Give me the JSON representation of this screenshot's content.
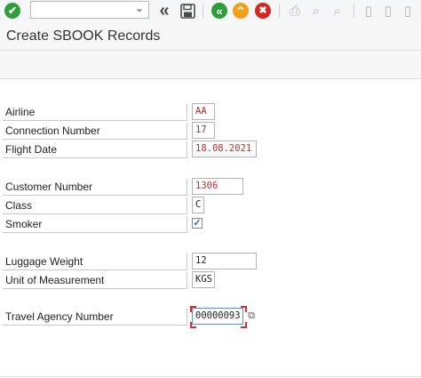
{
  "toolbar": {
    "command_field_value": "",
    "icons": [
      "enter-icon",
      "dropdown-chevron-icon",
      "back-chevron-icon",
      "save-icon",
      "back-icon",
      "exit-icon",
      "cancel-icon",
      "print-icon",
      "find-icon",
      "find-next-icon",
      "first-page-icon",
      "previous-page-icon",
      "next-page-icon"
    ],
    "glyphs": {
      "enter": "✔",
      "chevron": "⌄",
      "double_left": "«",
      "back": "«",
      "exit": "⌃",
      "cancel": "✖",
      "print": "⎙",
      "find": "⌕",
      "find_next": "⌕",
      "page_a": "▯",
      "page_b": "▯",
      "page_c": "▯"
    },
    "colors": {
      "enter": "#2e9d3a",
      "back": "#2e9d3a",
      "exit": "#f0a21a",
      "cancel": "#d7261e"
    }
  },
  "title": "Create SBOOK Records",
  "form": {
    "airline": {
      "label": "Airline",
      "value": "AA"
    },
    "connection_number": {
      "label": "Connection Number",
      "value": "17"
    },
    "flight_date": {
      "label": "Flight Date",
      "value": "18.08.2021"
    },
    "customer_number": {
      "label": "Customer Number",
      "value": "1306"
    },
    "class": {
      "label": "Class",
      "value": "C"
    },
    "smoker": {
      "label": "Smoker",
      "checked": true,
      "mark": "✓"
    },
    "luggage_weight": {
      "label": "Luggage Weight",
      "value": "12"
    },
    "unit_of_measurement": {
      "label": "Unit of Measurement",
      "value": "KGS"
    },
    "travel_agency_number": {
      "label": "Travel Agency Number",
      "value": "00000093"
    }
  },
  "value_help_glyph": "⧉",
  "colors": {
    "required_value_text": "#b4302a",
    "focus_corner": "#d0312d"
  }
}
